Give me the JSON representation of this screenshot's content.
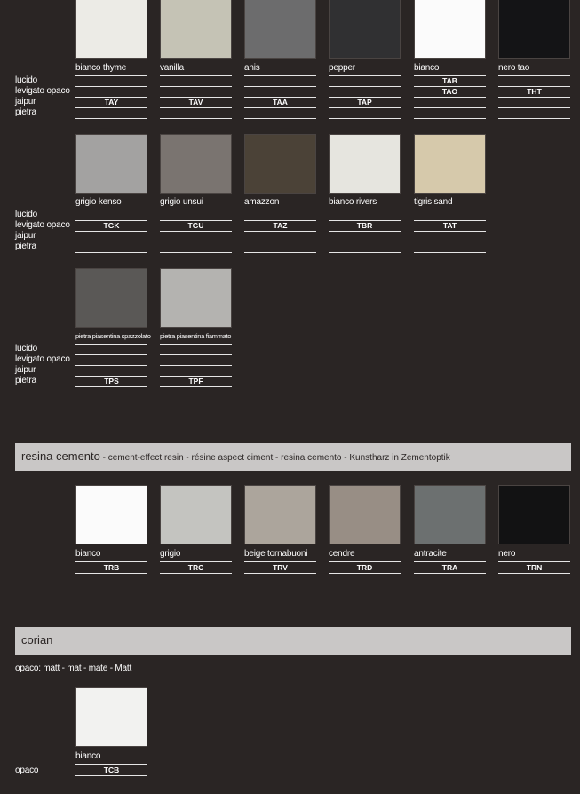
{
  "finish_labels": [
    "lucido",
    "levigato opaco",
    "jaipur",
    "pietra"
  ],
  "quartz": [
    {
      "name": "bianco thyme",
      "color": "#ecebe6",
      "codes": [
        "",
        "",
        "TAY",
        ""
      ]
    },
    {
      "name": "vanilla",
      "color": "#c5c3b5",
      "codes": [
        "",
        "",
        "TAV",
        ""
      ]
    },
    {
      "name": "anis",
      "color": "#6c6c6d",
      "codes": [
        "",
        "",
        "TAA",
        ""
      ]
    },
    {
      "name": "pepper",
      "color": "#303032",
      "codes": [
        "",
        "",
        "TAP",
        ""
      ]
    },
    {
      "name": "bianco",
      "color": "#fbfbfb",
      "codes": [
        "TAB",
        "TAO",
        "",
        ""
      ]
    },
    {
      "name": "nero tao",
      "color": "#141416",
      "codes": [
        "",
        "THT",
        "",
        ""
      ]
    },
    {
      "name": "grigio kenso",
      "color": "#a3a2a1",
      "codes": [
        "",
        "TGK",
        "",
        ""
      ]
    },
    {
      "name": "grigio unsui",
      "color": "#7a7470",
      "codes": [
        "",
        "TGU",
        "",
        ""
      ]
    },
    {
      "name": "amazzon",
      "color": "#4b4237",
      "codes": [
        "",
        "TAZ",
        "",
        ""
      ]
    },
    {
      "name": "bianco rivers",
      "color": "#e6e5df",
      "codes": [
        "",
        "TBR",
        "",
        ""
      ]
    },
    {
      "name": "tigris sand",
      "color": "#d6c9ab",
      "codes": [
        "",
        "TAT",
        "",
        ""
      ]
    },
    {
      "name": "pietra piasentina spazzolato",
      "color": "#5a5856",
      "codes": [
        "",
        "",
        "",
        "TPS"
      ]
    },
    {
      "name": "pietra piasentina fiammato",
      "color": "#b4b3b0",
      "codes": [
        "",
        "",
        "",
        "TPF"
      ]
    }
  ],
  "resina": {
    "title": "resina cemento",
    "subtitle": " - cement-effect resin - résine aspect ciment - resina cemento - Kunstharz in Zementoptik",
    "items": [
      {
        "name": "bianco",
        "code": "TRB",
        "color": "#fbfbfb"
      },
      {
        "name": "grigio",
        "code": "TRC",
        "color": "#c4c4c0"
      },
      {
        "name": "beige tornabuoni",
        "code": "TRV",
        "color": "#aca59c"
      },
      {
        "name": "cendre",
        "code": "TRD",
        "color": "#988e85"
      },
      {
        "name": "antracite",
        "code": "TRA",
        "color": "#6c7070"
      },
      {
        "name": "nero",
        "code": "TRN",
        "color": "#121213"
      }
    ]
  },
  "corian": {
    "title": "corian",
    "note": "opaco: matt - mat - mate - Matt",
    "row_label": "opaco",
    "items": [
      {
        "name": "bianco",
        "code": "TCB",
        "color": "#f2f2f0"
      }
    ]
  }
}
